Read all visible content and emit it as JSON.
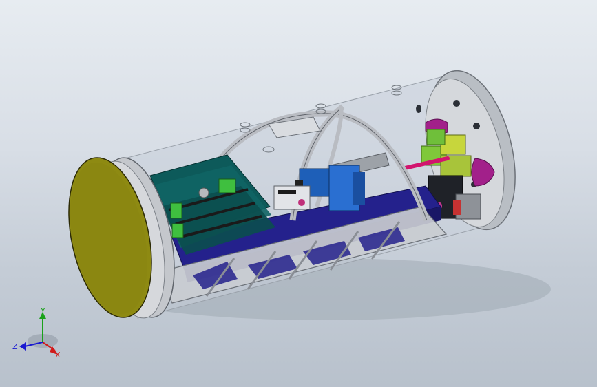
{
  "triad": {
    "x_label": "X",
    "y_label": "Y",
    "z_label": "Z"
  },
  "colors": {
    "background_top": "#e7ecf1",
    "background_bottom": "#b8c1cc",
    "end_cap": "#8e8a12",
    "frame": "#c9ccd1",
    "battery": "#24218c",
    "arduino_board": "#0d5a5a",
    "relay": "#2a6fd1",
    "terminal_block": "#3fbf3f",
    "purple_mount": "#a2208a",
    "rod": "#d2146e",
    "x_axis": "#d11a1a",
    "y_axis": "#1aa11a",
    "z_axis": "#1a1ad1"
  }
}
